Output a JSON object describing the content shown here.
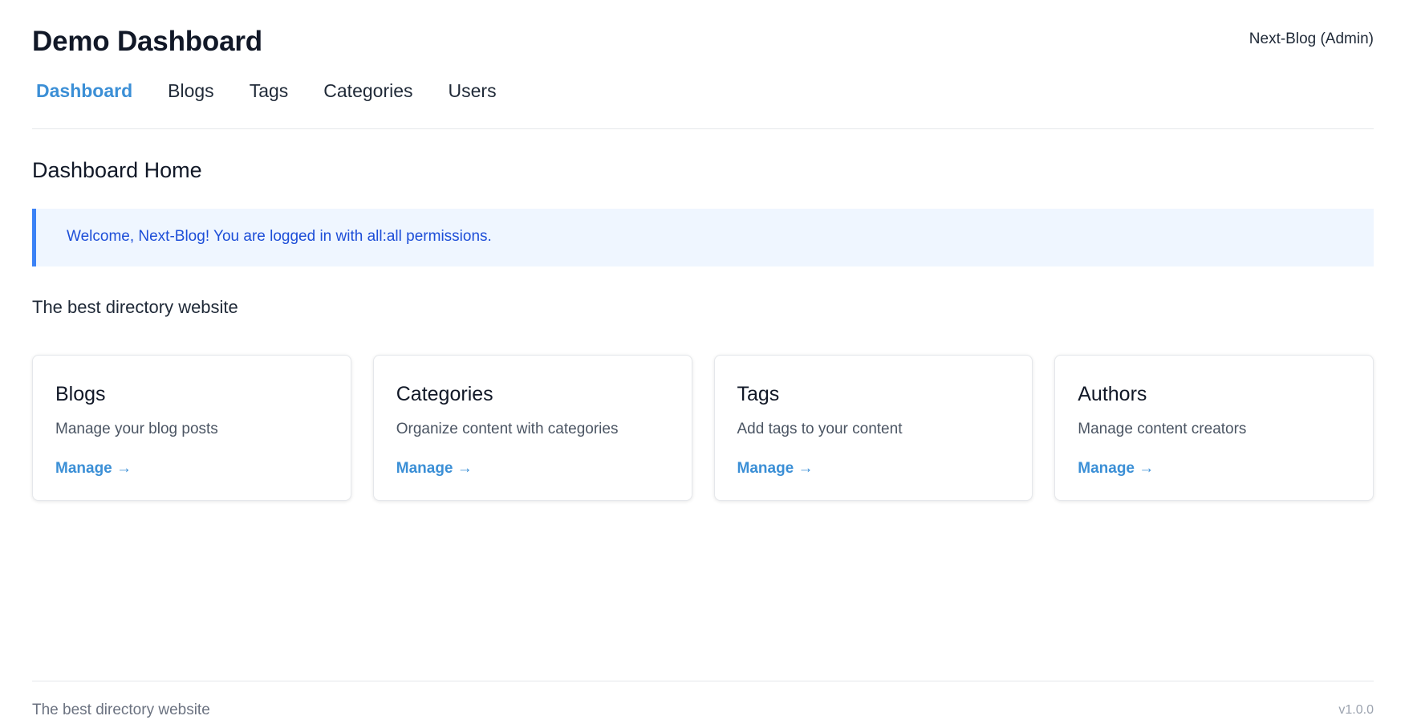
{
  "header": {
    "title": "Demo Dashboard",
    "user": "Next-Blog (Admin)"
  },
  "nav": {
    "items": [
      {
        "label": "Dashboard",
        "active": true
      },
      {
        "label": "Blogs",
        "active": false
      },
      {
        "label": "Tags",
        "active": false
      },
      {
        "label": "Categories",
        "active": false
      },
      {
        "label": "Users",
        "active": false
      }
    ]
  },
  "main": {
    "title": "Dashboard Home",
    "alert": "Welcome, Next-Blog! You are logged in with all:all permissions.",
    "subtitle": "The best directory website",
    "cards": [
      {
        "title": "Blogs",
        "description": "Manage your blog posts",
        "link": "Manage →"
      },
      {
        "title": "Categories",
        "description": "Organize content with categories",
        "link": "Manage →"
      },
      {
        "title": "Tags",
        "description": "Add tags to your content",
        "link": "Manage →"
      },
      {
        "title": "Authors",
        "description": "Manage content creators",
        "link": "Manage →"
      }
    ]
  },
  "footer": {
    "left": "The best directory website",
    "version": "v1.0.0"
  },
  "colors": {
    "accent": "#3b8fd6",
    "alert_bg": "#eff6ff",
    "alert_border": "#3b82f6",
    "alert_text": "#1d4ed8"
  }
}
